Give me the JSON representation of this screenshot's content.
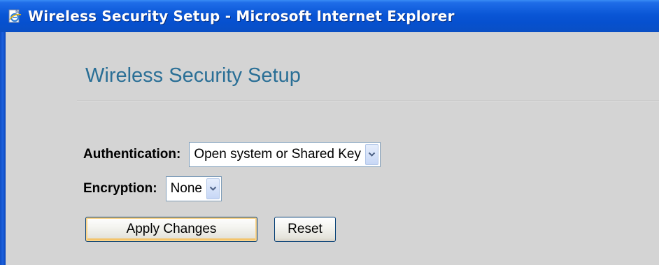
{
  "window": {
    "title": "Wireless Security Setup - Microsoft Internet Explorer",
    "icon": "ie-page-icon",
    "titlebar_color": "#0a56d6"
  },
  "page": {
    "heading": "Wireless Security Setup",
    "heading_color": "#2a6f96"
  },
  "form": {
    "authentication": {
      "label": "Authentication:",
      "selected": "Open system or Shared Key"
    },
    "encryption": {
      "label": "Encryption:",
      "selected": "None"
    },
    "buttons": {
      "apply_label": "Apply Changes",
      "reset_label": "Reset"
    }
  }
}
